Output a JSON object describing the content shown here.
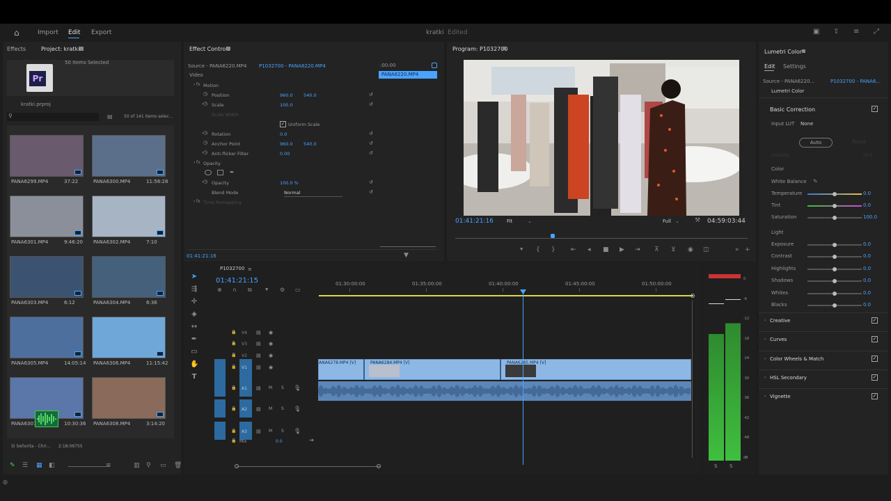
{
  "topbar": {
    "tabs": [
      "Import",
      "Edit",
      "Export"
    ],
    "active_tab": "Edit",
    "project_title": "kratki",
    "status": "Edited"
  },
  "project": {
    "tabs": [
      "Effects",
      "Project: kratki"
    ],
    "selection": "50 Items Selected",
    "file_name": "kratki.prproj",
    "count": "50 of 141 items selec...",
    "items": [
      {
        "name": "PANA6299.MP4",
        "dur": "37:22"
      },
      {
        "name": "PANA6300.MP4",
        "dur": "11:58:28"
      },
      {
        "name": "PANA6301.MP4",
        "dur": "9:46:20"
      },
      {
        "name": "PANA6302.MP4",
        "dur": "7:10"
      },
      {
        "name": "PANA6303.MP4",
        "dur": "6:12"
      },
      {
        "name": "PANA6304.MP4",
        "dur": "6:36"
      },
      {
        "name": "PANA6305.MP4",
        "dur": "14:05:14"
      },
      {
        "name": "PANA6306.MP4",
        "dur": "11:15:42"
      },
      {
        "name": "PANA6307.MP4",
        "dur": "10:30:36"
      },
      {
        "name": "PANA6308.MP4",
        "dur": "3:14:20"
      }
    ],
    "audio_item": {
      "name": "Si Señorita - Chri...",
      "dur": "2:18:06755"
    }
  },
  "effect_controls": {
    "title": "Effect Controls",
    "source": "Source - PANA6220.MP4",
    "sequence": "P1032700 - PANA6220.MP4",
    "video_label": "Video",
    "time_ruler": ":00:00",
    "clip_label": "PANA6220.MP4",
    "motion": "Motion",
    "position_label": "Position",
    "position_x": "960.0",
    "position_y": "540.0",
    "scale_label": "Scale",
    "scale_val": "100.0",
    "scale_width_label": "Scale Width",
    "uniform_label": "Uniform Scale",
    "rotation_label": "Rotation",
    "rotation_val": "0.0",
    "anchor_label": "Anchor Point",
    "anchor_x": "960.0",
    "anchor_y": "540.0",
    "antiflicker_label": "Anti-flicker Filter",
    "antiflicker_val": "0.00",
    "opacity_group": "Opacity",
    "opacity_label": "Opacity",
    "opacity_val": "100.0 %",
    "blend_label": "Blend Mode",
    "blend_val": "Normal",
    "time_remap": "Time Remapping",
    "timecode": "01:41:21:16"
  },
  "program": {
    "title": "Program: P1032700",
    "timecode": "01:41:21:16",
    "fit": "Fit",
    "quality": "Full",
    "duration": "04:59:03:44"
  },
  "timeline": {
    "seq_name": "P1032700",
    "timecode": "01:41:21:15",
    "ruler": [
      "01:30:00:00",
      "01:35:00:00",
      "01:40:00:00",
      "01:45:00:00",
      "01:50:00:00"
    ],
    "video_tracks": [
      "V4",
      "V3",
      "V2",
      "V1"
    ],
    "audio_tracks": [
      "A1",
      "A2",
      "A3"
    ],
    "mix_label": "Mix",
    "mix_val": "0.0",
    "clips": [
      "ANA6278.MP4 [V]",
      "PANA6284.MP4 [V]",
      "PANA6285.MP4 [V]"
    ]
  },
  "meter": {
    "scale": [
      "0",
      "-6",
      "-12",
      "-18",
      "-24",
      "-30",
      "-36",
      "-42",
      "-48",
      "dB"
    ],
    "solo": [
      "S",
      "S"
    ]
  },
  "lumetri": {
    "title": "Lumetri Color",
    "tabs": [
      "Edit",
      "Settings"
    ],
    "source": "Source - PANA6220...",
    "sequence": "P1032700 - PANA6...",
    "effect": "Lumetri Color",
    "basic": "Basic Correction",
    "input_lut_label": "Input LUT",
    "input_lut_val": "None",
    "auto_btn": "Auto",
    "reset_btn": "Reset",
    "intensity_label": "Intensity",
    "intensity_val": "50.0",
    "color_section": "Color",
    "white_balance": "White Balance",
    "color_rows": [
      {
        "label": "Temperature",
        "val": "0.0"
      },
      {
        "label": "Tint",
        "val": "0.0"
      },
      {
        "label": "Saturation",
        "val": "100.0"
      }
    ],
    "light_section": "Light",
    "light_rows": [
      {
        "label": "Exposure",
        "val": "0.0"
      },
      {
        "label": "Contrast",
        "val": "0.0"
      },
      {
        "label": "Highlights",
        "val": "0.0"
      },
      {
        "label": "Shadows",
        "val": "0.0"
      },
      {
        "label": "Whites",
        "val": "0.0"
      },
      {
        "label": "Blacks",
        "val": "0.0"
      }
    ],
    "sections": [
      "Creative",
      "Curves",
      "Color Wheels & Match",
      "HSL Secondary",
      "Vignette"
    ]
  },
  "colors": {
    "accent": "#4aa3ff",
    "clip": "#8db8e6",
    "playhead": "#4aa3ff",
    "meter_green": "#3fbf3f"
  }
}
